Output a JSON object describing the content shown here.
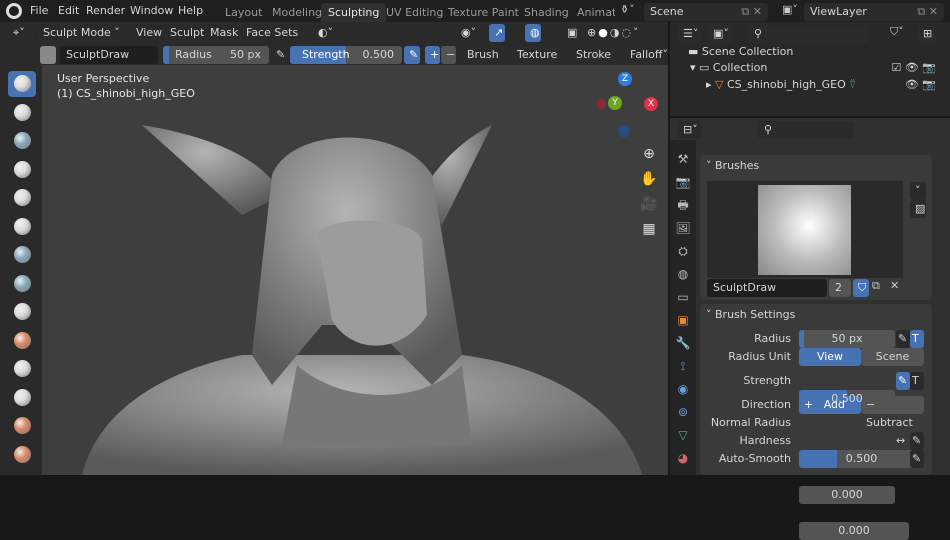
{
  "menus": [
    "File",
    "Edit",
    "Render",
    "Window",
    "Help"
  ],
  "workspaces": [
    "Layout",
    "Modeling",
    "Sculpting",
    "UV Editing",
    "Texture Paint",
    "Shading",
    "Animati"
  ],
  "active_workspace": "Sculpting",
  "scene": "Scene",
  "view_layer": "ViewLayer",
  "header": {
    "mode": "Sculpt Mode",
    "menus": [
      "View",
      "Sculpt",
      "Mask",
      "Face Sets"
    ],
    "brush": "SculptDraw",
    "radius_label": "Radius",
    "radius": "50 px",
    "strength_label": "Strength",
    "strength": "0.500",
    "dropdowns": [
      "Brush",
      "Texture",
      "Stroke",
      "Falloff"
    ]
  },
  "viewport": {
    "perspective": "User Perspective",
    "object": "(1) CS_shinobi_high_GEO",
    "gizmo": {
      "z": "Z",
      "y": "Y",
      "x": "X"
    }
  },
  "outliner": {
    "root": "Scene Collection",
    "collection": "Collection",
    "object": "CS_shinobi_high_GEO"
  },
  "brushes": {
    "title": "Brushes",
    "name": "SculptDraw",
    "users": "2"
  },
  "brush_settings": {
    "title": "Brush Settings",
    "radius_label": "Radius",
    "radius": "50 px",
    "radius_fraction": 0.05,
    "radius_unit_label": "Radius Unit",
    "unit_view": "View",
    "unit_scene": "Scene",
    "strength_label": "Strength",
    "strength": "0.500",
    "strength_fraction": 0.5,
    "direction_label": "Direction",
    "add": "Add",
    "subtract": "Subtract",
    "normal_radius_label": "Normal Radius",
    "normal_radius": "0.500",
    "normal_radius_fraction": 0.5,
    "hardness_label": "Hardness",
    "hardness": "0.000",
    "autosmooth_label": "Auto-Smooth",
    "autosmooth": "0.000"
  },
  "colors": {
    "accent": "#4772b3",
    "x_axis": "#e0324b",
    "y_axis": "#6ca623",
    "z_axis": "#2f7de0"
  }
}
